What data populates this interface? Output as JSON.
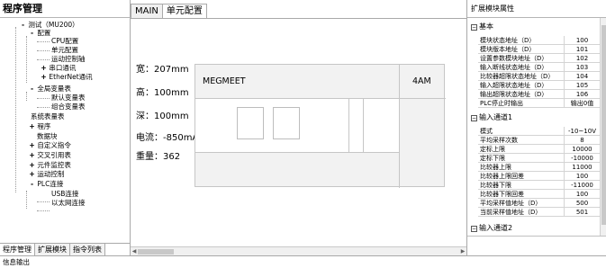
{
  "left_panel": {
    "title": "程序管理",
    "tree": [
      {
        "label": "测试（MU200）",
        "prefix": "-"
      },
      {
        "label": "配置",
        "prefix": "-"
      },
      {
        "label": "CPU配置",
        "prefix": ""
      },
      {
        "label": "单元配置",
        "prefix": ""
      },
      {
        "label": "运动控制轴",
        "prefix": ""
      },
      {
        "label": "串口通讯",
        "prefix": "+"
      },
      {
        "label": "EtherNet通讯",
        "prefix": "+"
      },
      {
        "label": "全局变量表",
        "prefix": "-"
      },
      {
        "label": "默认变量表",
        "prefix": ""
      },
      {
        "label": "组合变量表",
        "prefix": ""
      },
      {
        "label": "系统表量表",
        "prefix": ""
      },
      {
        "label": "程序",
        "prefix": "+"
      },
      {
        "label": "数据块",
        "prefix": ""
      },
      {
        "label": "自定义指令",
        "prefix": "+"
      },
      {
        "label": "交叉引用表",
        "prefix": "+"
      },
      {
        "label": "元件监控表",
        "prefix": "+"
      },
      {
        "label": "运动控制",
        "prefix": "+"
      },
      {
        "label": "PLC连接",
        "prefix": "-"
      },
      {
        "label": "USB连接",
        "prefix": ""
      },
      {
        "label": "以太网连接",
        "prefix": ""
      }
    ],
    "tabs": [
      "程序管理",
      "扩展模块",
      "指令列表"
    ]
  },
  "center": {
    "tabs": [
      "MAIN",
      "单元配置"
    ],
    "info": {
      "width": "宽：207mm",
      "height": "高：100mm",
      "depth": "深：100mm",
      "current": "电流：-850mA",
      "weight": "重量：362"
    },
    "module": {
      "brand": "MEGMEET",
      "model": "4AM"
    }
  },
  "right_panel": {
    "title": "扩展模块属性",
    "sections": [
      {
        "name": "基本",
        "rows": [
          {
            "name": "模块状态地址（D）",
            "value": "100"
          },
          {
            "name": "模块版本地址（D）",
            "value": "101"
          },
          {
            "name": "设置参数模块地址（D）",
            "value": "102"
          },
          {
            "name": "输入断线状态地址（D）",
            "value": "103"
          },
          {
            "name": "比较器超限状态地址（D）",
            "value": "104"
          },
          {
            "name": "输入超限状态地址（D）",
            "value": "105"
          },
          {
            "name": "输出超限状态地址（D）",
            "value": "106"
          },
          {
            "name": "PLC停止时输出",
            "value": "输出0值"
          }
        ]
      },
      {
        "name": "输入通道1",
        "rows": [
          {
            "name": "模式",
            "value": "-10~10V"
          },
          {
            "name": "平均采样次数",
            "value": "8"
          },
          {
            "name": "定标上限",
            "value": "10000"
          },
          {
            "name": "定标下限",
            "value": "-10000"
          },
          {
            "name": "比较器上限",
            "value": "11000"
          },
          {
            "name": "比较器上限回差",
            "value": "100"
          },
          {
            "name": "比较器下限",
            "value": "-11000"
          },
          {
            "name": "比较器下限回差",
            "value": "100"
          },
          {
            "name": "平均采样值地址（D）",
            "value": "500"
          },
          {
            "name": "当前采样值地址（D）",
            "value": "501"
          }
        ]
      },
      {
        "name": "输入通道2",
        "rows": []
      }
    ]
  },
  "status_bar": {
    "text": "信息输出"
  }
}
